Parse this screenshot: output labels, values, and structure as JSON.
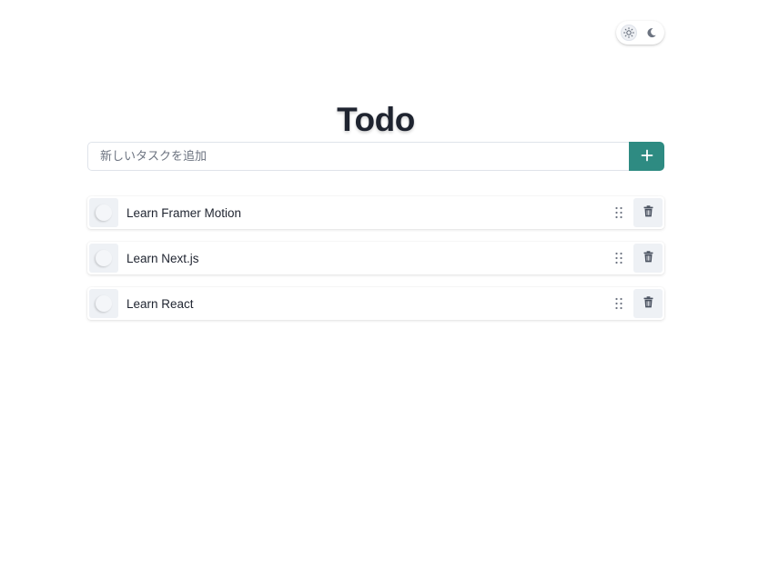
{
  "header": {
    "theme_toggle": {
      "options": [
        {
          "icon": "sun-icon",
          "active": true
        },
        {
          "icon": "moon-icon",
          "active": false
        }
      ]
    },
    "title": "Todo"
  },
  "add_form": {
    "placeholder": "新しいタスクを追加",
    "value": "",
    "button_icon": "plus-icon"
  },
  "todos": [
    {
      "label": "Learn Framer Motion",
      "completed": false
    },
    {
      "label": "Learn Next.js",
      "completed": false
    },
    {
      "label": "Learn React",
      "completed": false
    }
  ],
  "colors": {
    "accent": "#2e8b82",
    "text": "#1f2430",
    "muted": "#6c7380",
    "icon": "#5a6372"
  }
}
